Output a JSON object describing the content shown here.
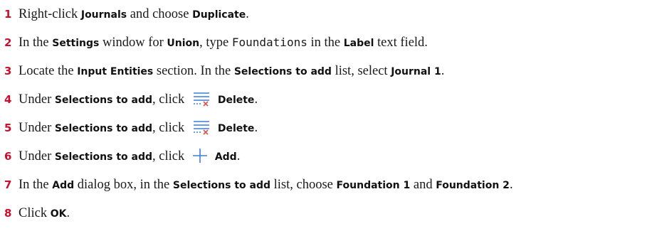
{
  "steps": [
    {
      "number": "1",
      "t1": "Right-click ",
      "b1": "Journals",
      "t2": " and choose ",
      "b2": "Duplicate",
      "t3": "."
    },
    {
      "number": "2",
      "t1": "In the ",
      "b1": "Settings",
      "t2": " window for ",
      "b2": "Union",
      "t3": ", type ",
      "code": "Foundations",
      "t4": " in the ",
      "b3": "Label",
      "t5": " text field."
    },
    {
      "number": "3",
      "t1": "Locate the ",
      "b1": "Input Entities",
      "t2": " section. In the ",
      "b2": "Selections to add",
      "t3": " list, select ",
      "b3": "Journal 1",
      "t4": "."
    },
    {
      "number": "4",
      "t1": "Under ",
      "b1": "Selections to add",
      "t2": ", click ",
      "icon": "delete-list-icon",
      "b2": "Delete",
      "t3": "."
    },
    {
      "number": "5",
      "t1": "Under ",
      "b1": "Selections to add",
      "t2": ", click ",
      "icon": "delete-list-icon",
      "b2": "Delete",
      "t3": "."
    },
    {
      "number": "6",
      "t1": "Under ",
      "b1": "Selections to add",
      "t2": ", click ",
      "icon": "add-plus-icon",
      "b2": "Add",
      "t3": "."
    },
    {
      "number": "7",
      "t1": "In the ",
      "b1": "Add",
      "t2": " dialog box, in the ",
      "b2": "Selections to add",
      "t3": " list, choose ",
      "b3": "Foundation 1",
      "t4": " and ",
      "b4": "Foundation 2",
      "t5": "."
    },
    {
      "number": "8",
      "t1": "Click ",
      "b1": "OK",
      "t2": "."
    }
  ],
  "colors": {
    "step_number": "#c8102e",
    "icon_blue": "#3a7fd5",
    "icon_red": "#d9534f"
  }
}
